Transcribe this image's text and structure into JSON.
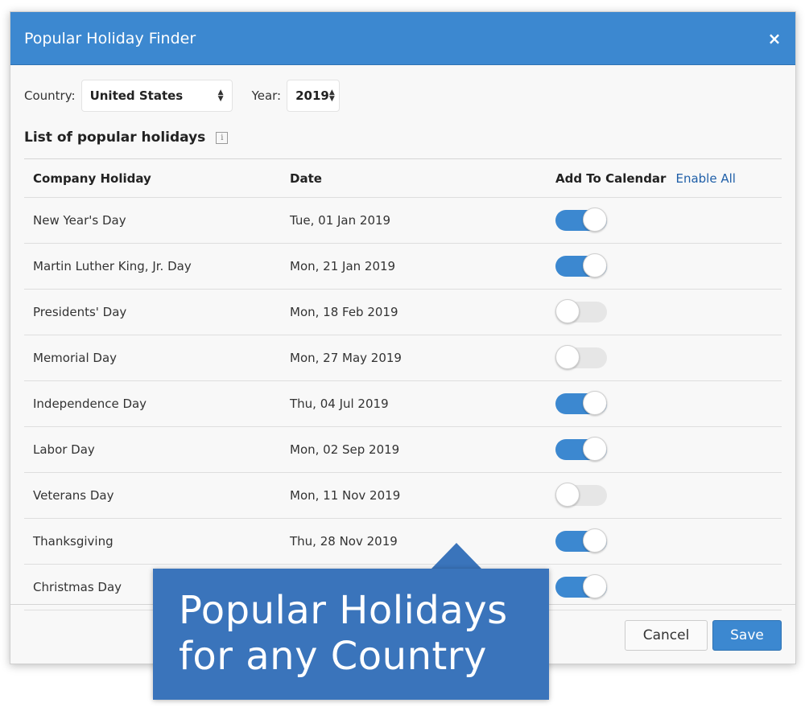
{
  "modal": {
    "title": "Popular Holiday Finder",
    "close_glyph": "×"
  },
  "filters": {
    "country_label": "Country:",
    "country_value": "United States",
    "year_label": "Year:",
    "year_value": "2019"
  },
  "list": {
    "title": "List of popular holidays",
    "info_glyph": "i",
    "headers": {
      "holiday": "Company Holiday",
      "date": "Date",
      "add": "Add To Calendar",
      "enable_all": "Enable All"
    },
    "rows": [
      {
        "name": "New Year's Day",
        "date": "Tue, 01 Jan 2019",
        "enabled": true
      },
      {
        "name": "Martin Luther King, Jr. Day",
        "date": "Mon, 21 Jan 2019",
        "enabled": true
      },
      {
        "name": "Presidents' Day",
        "date": "Mon, 18 Feb 2019",
        "enabled": false
      },
      {
        "name": "Memorial Day",
        "date": "Mon, 27 May 2019",
        "enabled": false
      },
      {
        "name": "Independence Day",
        "date": "Thu, 04 Jul 2019",
        "enabled": true
      },
      {
        "name": "Labor Day",
        "date": "Mon, 02 Sep 2019",
        "enabled": true
      },
      {
        "name": "Veterans Day",
        "date": "Mon, 11 Nov 2019",
        "enabled": false
      },
      {
        "name": "Thanksgiving",
        "date": "Thu, 28 Nov 2019",
        "enabled": true
      },
      {
        "name": "Christmas Day",
        "date": "",
        "enabled": true
      }
    ]
  },
  "footer": {
    "cancel_label": "Cancel",
    "save_label": "Save"
  },
  "callout": {
    "line1": "Popular Holidays",
    "line2": "for any Country"
  },
  "colors": {
    "accent": "#3c88d0",
    "callout": "#3a74bb",
    "link": "#1f5fa8"
  }
}
